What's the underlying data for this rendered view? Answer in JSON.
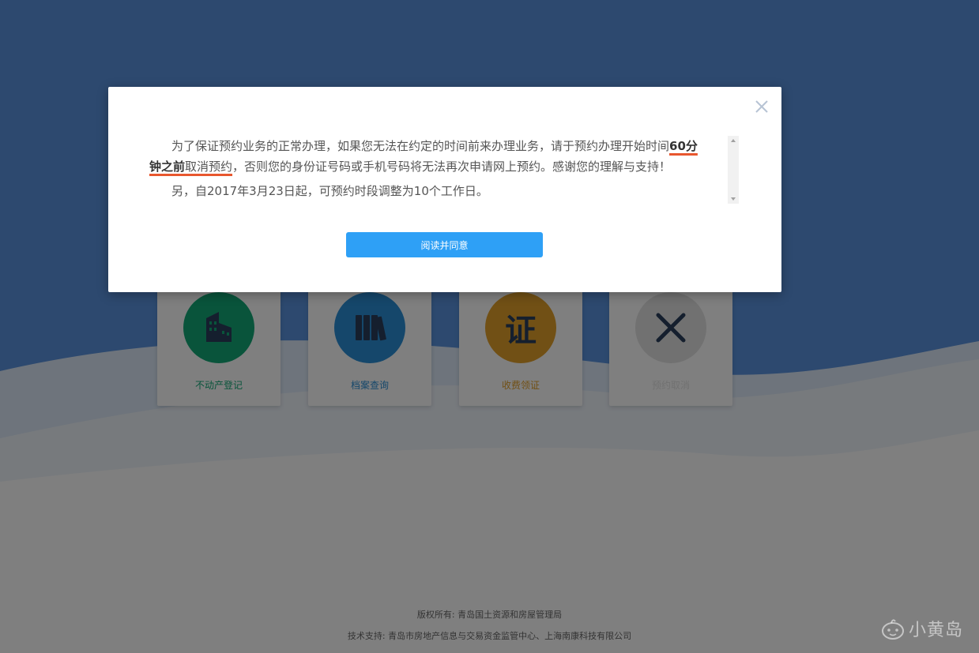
{
  "modal": {
    "paragraph1_before": "为了保证预约业务的正常办理，如果您无法在约定的时间前来办理业务，请于预约办理开始时间",
    "paragraph1_bold": "60分钟之前",
    "paragraph1_underline": "取消预约",
    "paragraph1_after": "，否则您的身份证号码或手机号码将无法再次申请网上预约。感谢您的理解与支持！",
    "paragraph2": "另，自2017年3月23日起，可预约时段调整为10个工作日。",
    "agree_label": "阅读并同意"
  },
  "cards": [
    {
      "label": "不动产登记",
      "icon": "building-icon",
      "color": "#13a977"
    },
    {
      "label": "档案查询",
      "icon": "books-icon",
      "color": "#2b8fd6"
    },
    {
      "label": "收费领证",
      "icon": "certificate-icon",
      "color": "#e3a02b",
      "glyph": "证"
    },
    {
      "label": "预约取消",
      "icon": "cancel-x-icon",
      "color": "#e3e3e3"
    }
  ],
  "footer": {
    "copyright": "版权所有: 青岛国土资源和房屋管理局",
    "support": "技术支持: 青岛市房地产信息与交易资金监管中心、上海南康科技有限公司"
  },
  "watermark": {
    "text": "小黄岛"
  }
}
